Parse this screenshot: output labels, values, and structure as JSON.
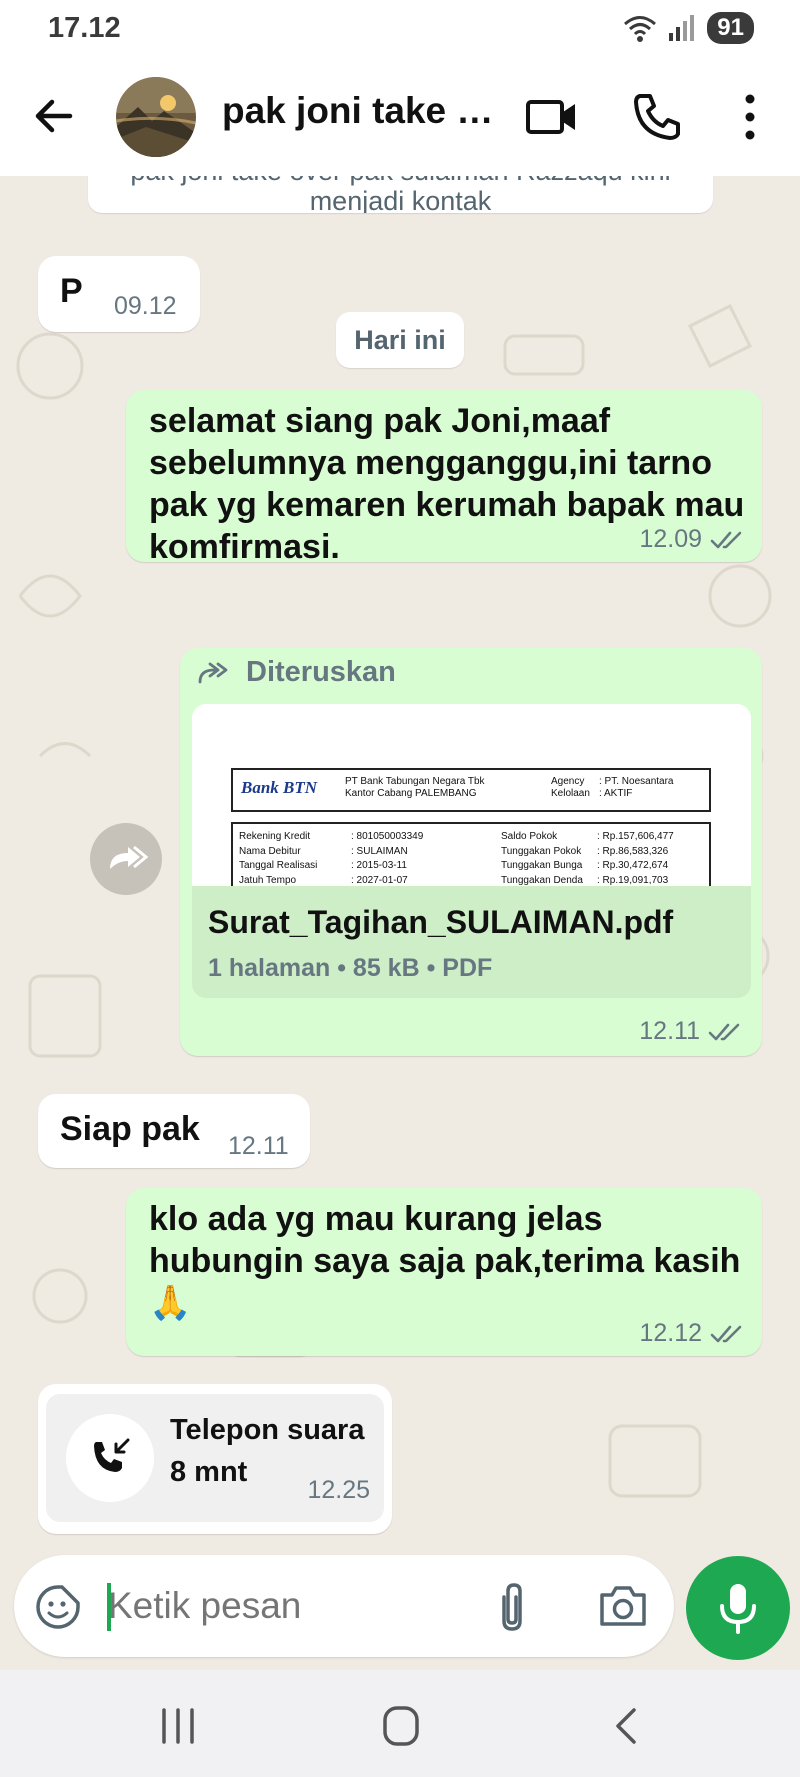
{
  "status_bar": {
    "time": "17.12",
    "battery": "91"
  },
  "header": {
    "title": "pak joni take o…"
  },
  "chat": {
    "system_top": "pak joni take over pak sulaiman Razzaqu kini menjadi kontak",
    "msg1": {
      "text": "P",
      "time": "09.12"
    },
    "date_chip": "Hari ini",
    "msg2": {
      "text": "selamat siang pak Joni,maaf sebelumnya mengganggu,ini tarno pak yg kemaren kerumah bapak mau komfirmasi.",
      "time": "12.09"
    },
    "forward": {
      "label": "Diteruskan",
      "preview": {
        "bank_logo": "Bank BTN",
        "bank_name": "PT Bank Tabungan Negara Tbk",
        "branch": "Kantor Cabang PALEMBANG",
        "agency_label": "Agency",
        "agency_value": ": PT. Noesantara",
        "kelolaan_label": "Kelolaan",
        "kelolaan_value": ": AKTIF",
        "rows": [
          {
            "k1": "Rekening Kredit",
            "v1": ": 801050003349",
            "k2": "Saldo Pokok",
            "v2": ": Rp.157,606,477"
          },
          {
            "k1": "Nama Debitur",
            "v1": ": SULAIMAN",
            "k2": "Tunggakan Pokok",
            "v2": ": Rp.86,583,326"
          },
          {
            "k1": "Tanggal Realisasi",
            "v1": ": 2015-03-11",
            "k2": "Tunggakan Bunga",
            "v2": ": Rp.30,472,674"
          },
          {
            "k1": "Jatuh Tempo",
            "v1": ": 2027-01-07",
            "k2": "Tunggakan Denda",
            "v2": ": Rp.19,091,703"
          }
        ]
      },
      "file_name": "Surat_Tagihan_SULAIMAN.pdf",
      "file_meta": "1 halaman • 85 kB • PDF",
      "time": "12.11"
    },
    "msg3": {
      "text": "Siap pak",
      "time": "12.11"
    },
    "msg4": {
      "text": "klo ada yg mau kurang jelas hubungin saya saja pak,terima kasih",
      "emoji": "🙏",
      "time": "12.12"
    },
    "call": {
      "title": "Telepon suara",
      "duration": "8 mnt",
      "time": "12.25"
    }
  },
  "composer": {
    "placeholder": "Ketik pesan"
  },
  "colors": {
    "accent": "#1da851",
    "outgoing_bubble": "#d9fdd3",
    "incoming_bubble": "#ffffff",
    "read_ticks": "#667781"
  }
}
